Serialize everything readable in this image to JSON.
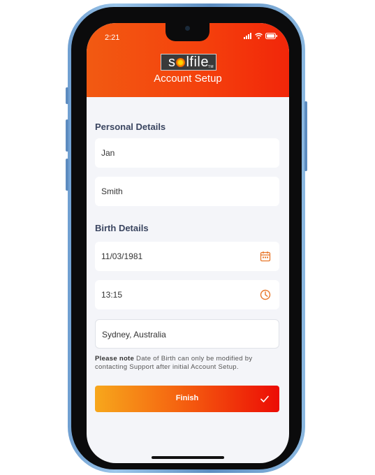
{
  "status_bar": {
    "time": "2:21",
    "icons": [
      "signal-icon",
      "wifi-icon",
      "battery-icon"
    ]
  },
  "header": {
    "logo": "solfile",
    "title": "Account Setup"
  },
  "personal_details": {
    "heading": "Personal Details",
    "first_name": "Jan",
    "last_name": "Smith"
  },
  "birth_details": {
    "heading": "Birth Details",
    "date": "11/03/1981",
    "date_icon": "calendar-icon",
    "time": "13:15",
    "time_icon": "clock-icon",
    "place": "Sydney, Australia"
  },
  "note": {
    "label": "Please note",
    "text": " Date of Birth can only be modified by contacting Support after initial Account Setup."
  },
  "finish_button": {
    "label": "Finish",
    "icon": "check-icon"
  },
  "colors": {
    "header_start": "#f25a12",
    "header_end": "#f22609",
    "button_start": "#f7a71c",
    "button_end": "#ec0c05",
    "icon_accent": "#e8772a",
    "heading_text": "#3a4560"
  }
}
